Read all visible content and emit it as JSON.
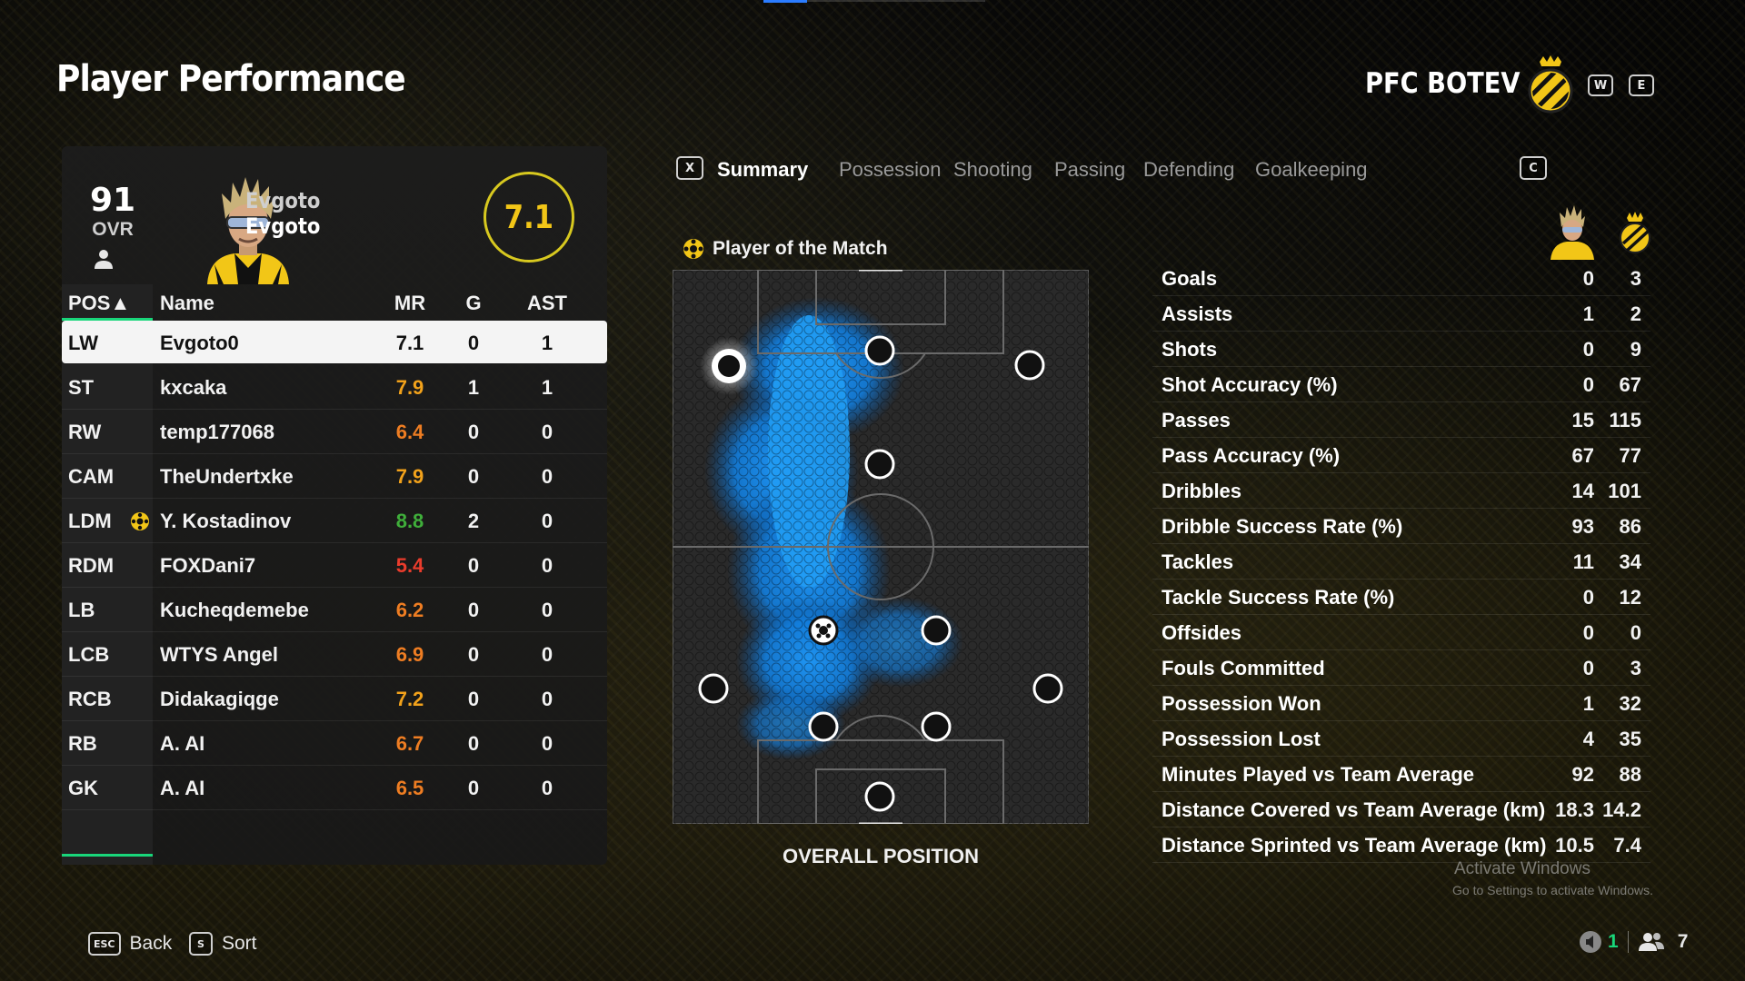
{
  "page_title": "Player Performance",
  "club": {
    "name": "PFC BOTEV",
    "primary_color": "#f2c617",
    "secondary_color": "#111111"
  },
  "header_keys": {
    "prev": "W",
    "next": "E"
  },
  "player_card": {
    "ovr": "91",
    "ovr_label": "OVR",
    "first_name": "Evgoto",
    "last_name": "Evgoto",
    "match_rating": "7.1"
  },
  "table": {
    "headers": {
      "pos": "POS▲",
      "name": "Name",
      "mr": "MR",
      "g": "G",
      "ast": "AST"
    },
    "rows": [
      {
        "pos": "LW",
        "name": "Evgoto0",
        "mr": "7.1",
        "mr_color": "#111111",
        "g": "0",
        "ast": "1",
        "selected": true
      },
      {
        "pos": "ST",
        "name": "kxcaka",
        "mr": "7.9",
        "mr_color": "#f2a21b",
        "g": "1",
        "ast": "1"
      },
      {
        "pos": "RW",
        "name": "temp177068",
        "mr": "6.4",
        "mr_color": "#ee7d22",
        "g": "0",
        "ast": "0"
      },
      {
        "pos": "CAM",
        "name": "TheUndertxke",
        "mr": "7.9",
        "mr_color": "#f2a21b",
        "g": "0",
        "ast": "0"
      },
      {
        "pos": "LDM",
        "name": "Y. Kostadinov",
        "mr": "8.8",
        "mr_color": "#3fae3a",
        "g": "2",
        "ast": "0",
        "potm": true
      },
      {
        "pos": "RDM",
        "name": "FOXDani7",
        "mr": "5.4",
        "mr_color": "#ea3c2c",
        "g": "0",
        "ast": "0"
      },
      {
        "pos": "LB",
        "name": "Kucheqdemebe",
        "mr": "6.2",
        "mr_color": "#ee7d22",
        "g": "0",
        "ast": "0"
      },
      {
        "pos": "LCB",
        "name": "WTYS Angel",
        "mr": "6.9",
        "mr_color": "#ee7d22",
        "g": "0",
        "ast": "0"
      },
      {
        "pos": "RCB",
        "name": "Didakagiqge",
        "mr": "7.2",
        "mr_color": "#f2a21b",
        "g": "0",
        "ast": "0"
      },
      {
        "pos": "RB",
        "name": "A. AI",
        "mr": "6.7",
        "mr_color": "#ee7d22",
        "g": "0",
        "ast": "0"
      },
      {
        "pos": "GK",
        "name": "A. AI",
        "mr": "6.5",
        "mr_color": "#ee7d22",
        "g": "0",
        "ast": "0"
      }
    ]
  },
  "tabs": {
    "prev_key": "X",
    "next_key": "C",
    "items": [
      "Summary",
      "Possession",
      "Shooting",
      "Passing",
      "Defending",
      "Goalkeeping"
    ],
    "active": "Summary"
  },
  "potm_label": "Player of the Match",
  "overall_position_label": "OVERALL POSITION",
  "stats": [
    {
      "label": "Goals",
      "player": "0",
      "team": "3"
    },
    {
      "label": "Assists",
      "player": "1",
      "team": "2"
    },
    {
      "label": "Shots",
      "player": "0",
      "team": "9"
    },
    {
      "label": "Shot Accuracy (%)",
      "player": "0",
      "team": "67"
    },
    {
      "label": "Passes",
      "player": "15",
      "team": "115"
    },
    {
      "label": "Pass Accuracy (%)",
      "player": "67",
      "team": "77"
    },
    {
      "label": "Dribbles",
      "player": "14",
      "team": "101"
    },
    {
      "label": "Dribble Success Rate (%)",
      "player": "93",
      "team": "86"
    },
    {
      "label": "Tackles",
      "player": "11",
      "team": "34"
    },
    {
      "label": "Tackle Success Rate (%)",
      "player": "0",
      "team": "12"
    },
    {
      "label": "Offsides",
      "player": "0",
      "team": "0"
    },
    {
      "label": "Fouls Committed",
      "player": "0",
      "team": "3"
    },
    {
      "label": "Possession Won",
      "player": "1",
      "team": "32"
    },
    {
      "label": "Possession Lost",
      "player": "4",
      "team": "35"
    },
    {
      "label": "Minutes Played vs Team Average",
      "player": "92",
      "team": "88"
    },
    {
      "label": "Distance Covered vs Team Average (km)",
      "player": "18.3",
      "team": "14.2"
    },
    {
      "label": "Distance Sprinted vs Team Average (km)",
      "player": "10.5",
      "team": "7.4"
    }
  ],
  "watermark": {
    "title": "Activate Windows",
    "subtitle": "Go to Settings to activate Windows."
  },
  "footer": {
    "back": {
      "key": "ESC",
      "label": "Back"
    },
    "sort": {
      "key": "S",
      "label": "Sort"
    },
    "status_green": "1",
    "players_count": "7"
  }
}
